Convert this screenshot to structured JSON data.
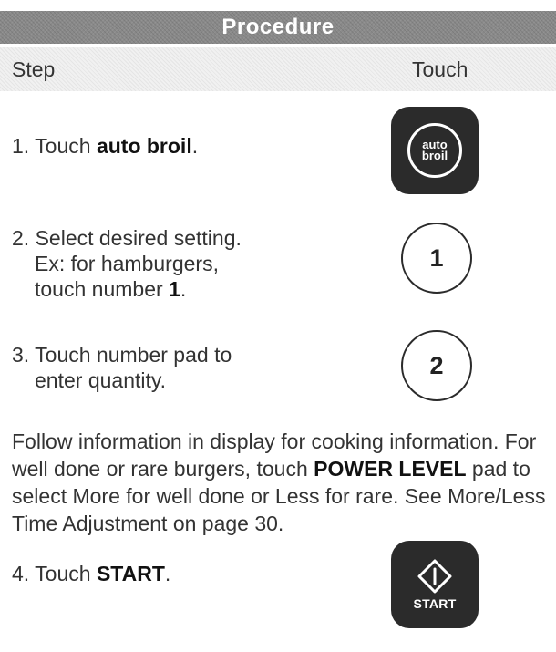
{
  "header": {
    "title": "Procedure"
  },
  "columns": {
    "step": "Step",
    "touch": "Touch"
  },
  "steps": [
    {
      "number": "1.",
      "prefix": "Touch ",
      "bold": "auto broil",
      "suffix": "."
    },
    {
      "number": "2.",
      "line1": "Select desired setting.",
      "line2": "Ex: for hamburgers,",
      "line3_prefix": "touch number ",
      "line3_bold": "1",
      "line3_suffix": "."
    },
    {
      "number": "3.",
      "line1": "Touch number pad to",
      "line2": "enter quantity."
    },
    {
      "number": "4.",
      "prefix": "Touch ",
      "bold": "START",
      "suffix": "."
    }
  ],
  "buttons": {
    "auto_broil": {
      "line1": "auto",
      "line2": "broil"
    },
    "num1": "1",
    "num2": "2",
    "start": "START"
  },
  "note": {
    "part1": "Follow information in display for cooking information. For well done or rare burgers, touch ",
    "bold": "POWER LEVEL",
    "part2": " pad to select More for well done or Less for rare. See More/Less Time Adjustment on page 30."
  }
}
